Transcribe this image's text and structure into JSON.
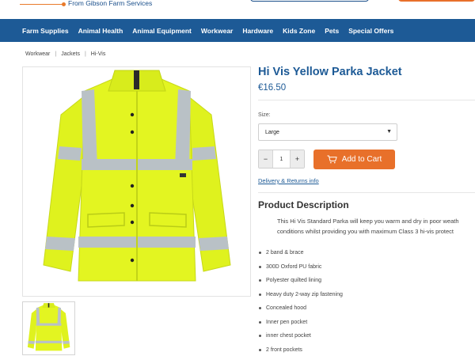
{
  "header": {
    "tagline": "From Gibson Farm Services"
  },
  "nav": {
    "items": [
      "Farm Supplies",
      "Animal Health",
      "Animal Equipment",
      "Workwear",
      "Hardware",
      "Kids Zone",
      "Pets",
      "Special Offers"
    ]
  },
  "breadcrumb": [
    "Workwear",
    "Jackets",
    "Hi-Vis"
  ],
  "product": {
    "title": "Hi Vis Yellow Parka Jacket",
    "price": "€16.50",
    "size_label": "Size:",
    "size_selected": "Large",
    "quantity": "1",
    "add_to_cart": "Add to Cart",
    "delivery_link": "Delivery & Returns info",
    "description_heading": "Product Description",
    "description_line1": "This Hi Vis Standard Parka will keep you warm and dry in poor weath",
    "description_line2": "conditions whilst providing you with maximum Class 3 hi-vis protect",
    "features": [
      "2 band & brace",
      "300D Oxford PU fabric",
      "Polyester quilted lining",
      "Heavy duty 2-way zip fastening",
      "Concealed hood",
      "Inner pen pocket",
      "inner chest pocket",
      "2 front pockets"
    ]
  },
  "icons": {
    "cart": "cart-icon",
    "minus": "minus-icon",
    "plus": "plus-icon",
    "chevron": "chevron-down-icon"
  },
  "colors": {
    "brand_blue": "#1d5a96",
    "accent_orange": "#e8702a",
    "hivis_yellow": "#dff21e",
    "reflective_grey": "#b9c1c6"
  }
}
